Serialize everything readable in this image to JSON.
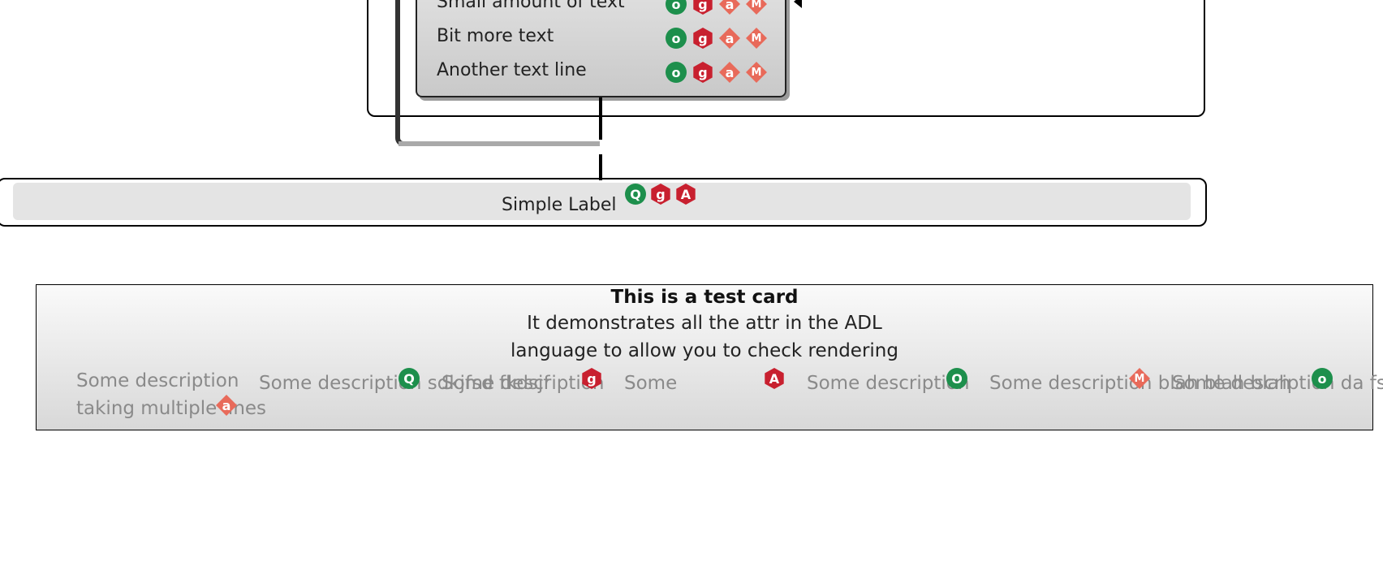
{
  "top_card": {
    "rows": [
      {
        "text": "Small amount of text",
        "badges": [
          "o",
          "g",
          "a",
          "M"
        ]
      },
      {
        "text": "Bit more text",
        "badges": [
          "o",
          "g",
          "a",
          "M"
        ]
      },
      {
        "text": "Another text line",
        "badges": [
          "o",
          "g",
          "a",
          "M"
        ]
      }
    ]
  },
  "simple_label": {
    "text": "Simple Label",
    "badges": [
      "Q",
      "g",
      "A"
    ]
  },
  "test_card": {
    "title": "This is a test card",
    "line1": "It demonstrates all the attr in the ADL",
    "line2": "language to allow you to check rendering",
    "descriptions": [
      {
        "line1": "Some description",
        "line2": "taking multiple lines",
        "badge": "a"
      },
      {
        "line1": "Some description sdkjfsd fkdsjf",
        "badge": "Q"
      },
      {
        "line1": "Some description",
        "badge": "g"
      },
      {
        "line1": "Some",
        "badge": "A"
      },
      {
        "line1": "Some description",
        "badge": "O"
      },
      {
        "line1": "Some description blah blah blah",
        "badge": "M"
      },
      {
        "line1": "Some description da fsdf sdf",
        "badge": "o"
      }
    ]
  },
  "colors": {
    "green_badge": "#1d8f4c",
    "red_badge": "#c8202f",
    "salmon_badge": "#e86a5a",
    "card_gray": "#d8d8d8"
  },
  "icons": {
    "circle": "circle-badge-icon",
    "hexagon": "hexagon-badge-icon",
    "diamond": "diamond-badge-icon"
  }
}
